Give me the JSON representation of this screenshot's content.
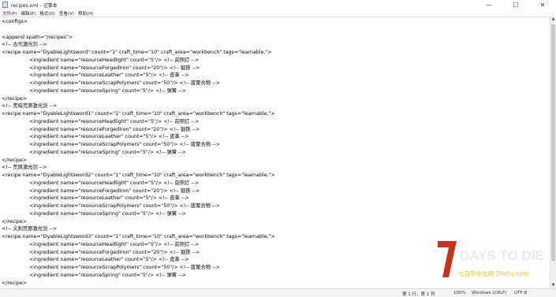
{
  "window": {
    "title": "recipes.xml - 记事本",
    "minimize": "—",
    "maximize": "☐",
    "close": "✕"
  },
  "menu": [
    "文件(F)",
    "编辑(E)",
    "格式(O)",
    "查看(V)",
    "帮助(H)"
  ],
  "lines": [
    "<configs>",
    "",
    "<append xpath=\"/recipes\">",
    "<!-- 古代激光剑 -->",
    "<recipe name=\"DyableLightsword\" count=\"1\" craft_time=\"10\" craft_area=\"workbench\" tags=\"learnable,\">",
    "<ingredient name=\"resourceHeadlight\" count=\"5\"/> <!-- 前照灯 -->",
    "<ingredient name=\"resourceForgedIron\" count=\"20\"/> <!-- 锻铁 -->",
    "<ingredient name=\"resourceLeather\" count=\"5\"/> <!-- 皮革 -->",
    "<ingredient name=\"resourceScrapPolymers\" count=\"50\"/> <!-- 废聚合物 -->",
    "<ingredient name=\"resourceSpring\" count=\"5\"/> <!-- 弹簧 -->",
    "</recipe>",
    "<!-- 黑暗荒原激光剑 -->",
    "<recipe name=\"DyableLightsword1\" count=\"1\" craft_time=\"10\" craft_area=\"workbench\" tags=\"learnable,\">",
    "<ingredient name=\"resourceHeadlight\" count=\"5\"/> <!-- 前照灯 -->",
    "<ingredient name=\"resourceForgedIron\" count=\"20\"/> <!-- 锻铁 -->",
    "<ingredient name=\"resourceLeather\" count=\"5\"/> <!-- 皮革 -->",
    "<ingredient name=\"resourceScrapPolymers\" count=\"50\"/> <!-- 废聚合物 -->",
    "<ingredient name=\"resourceSpring\" count=\"5\"/> <!-- 弹簧 -->",
    "</recipe>",
    "<!-- 荒原激光剑 -->",
    "<recipe name=\"DyableLightsword2\" count=\"1\" craft_time=\"10\" craft_area=\"workbench\" tags=\"learnable,\">",
    "<ingredient name=\"resourceHeadlight\" count=\"5\"/> <!-- 前照灯 -->",
    "<ingredient name=\"resourceForgedIron\" count=\"20\"/> <!-- 锻铁 -->",
    "<ingredient name=\"resourceLeather\" count=\"5\"/> <!-- 皮革 -->",
    "<ingredient name=\"resourceScrapPolymers\" count=\"50\"/> <!-- 废聚合物 -->",
    "<ingredient name=\"resourceSpring\" count=\"5\"/> <!-- 弹簧 -->",
    "</recipe>",
    "<!-- 尖刺荒原激光剑 -->",
    "<recipe name=\"DyableLightsword3\" count=\"1\" craft_time=\"10\" craft_area=\"workbench\" tags=\"learnable,\">",
    "<ingredient name=\"resourceHeadlight\" count=\"5\"/> <!-- 前照灯 -->",
    "<ingredient name=\"resourceForgedIron\" count=\"20\"/> <!-- 锻铁 -->",
    "<ingredient name=\"resourceLeather\" count=\"5\"/> <!-- 皮革 -->",
    "<ingredient name=\"resourceScrapPolymers\" count=\"50\"/> <!-- 废聚合物 -->",
    "<ingredient name=\"resourceSpring\" count=\"5\"/> <!-- 弹簧 -->",
    "</recipe>"
  ],
  "status": {
    "position": "第 1 行，第 1 列",
    "zoom": "100%",
    "line_ending": "Windows (CRLF)",
    "encoding": "UTF-8"
  },
  "watermark": {
    "logo": "7DAYS TO DIE",
    "sub": "七日杀中文网 7rishu.com"
  },
  "colors": {
    "logo_red": "#c8331c",
    "logo_text": "#eaeaea"
  }
}
